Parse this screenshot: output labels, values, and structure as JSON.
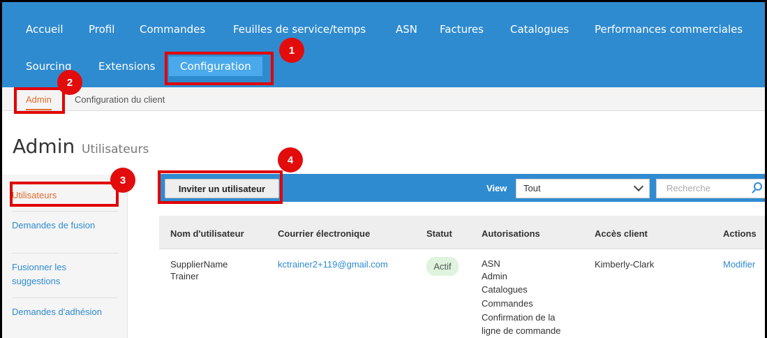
{
  "nav": {
    "items": [
      "Accueil",
      "Profil",
      "Commandes",
      "Feuilles de service/temps",
      "ASN",
      "Factures",
      "Catalogues",
      "Performances commerciales"
    ],
    "row2": [
      "Sourcing",
      "Extensions",
      "Configuration"
    ]
  },
  "subnav": {
    "admin": "Admin",
    "client_config": "Configuration du client"
  },
  "page": {
    "title": "Admin",
    "subtitle": "Utilisateurs"
  },
  "sidebar": {
    "items": [
      {
        "label": "Utilisateurs",
        "active": true
      },
      {
        "label": "Demandes de fusion"
      },
      {
        "label": "Fusionner les suggestions"
      },
      {
        "label": "Demandes d'adhésion"
      }
    ]
  },
  "toolbar": {
    "invite_label": "Inviter un utilisateur",
    "view_label": "View",
    "view_value": "Tout",
    "search_placeholder": "Recherche"
  },
  "table": {
    "headers": [
      "Nom d'utilisateur",
      "Courrier électronique",
      "Statut",
      "Autorisations",
      "Accès client",
      "Actions"
    ],
    "rows": [
      {
        "name": "SupplierName Trainer",
        "email": "kctrainer2+119@gmail.com",
        "status": "Actif",
        "permissions": [
          "ASN",
          "Admin",
          "Catalogues",
          "Commandes",
          "Confirmation de la",
          "ligne de commande"
        ],
        "client_access": "Kimberly-Clark",
        "action": "Modifier"
      }
    ]
  },
  "annotations": [
    "1",
    "2",
    "3",
    "4"
  ],
  "colors": {
    "nav_bg": "#2f8bd0",
    "active_tab": "#4aa9ea",
    "accent_orange": "#e06b2c",
    "annotation_red": "#e00000"
  }
}
